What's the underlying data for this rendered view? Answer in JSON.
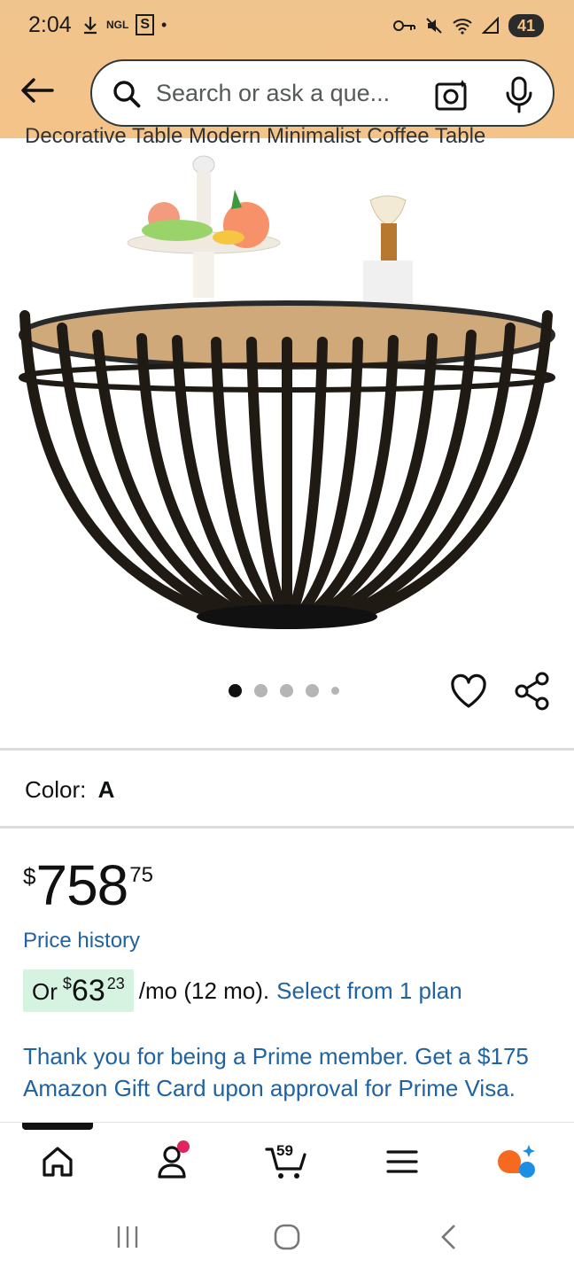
{
  "status_bar": {
    "time": "2:04",
    "left_icons": [
      "download-icon",
      "NGL",
      "S",
      "•"
    ],
    "right_icons": [
      "key-icon",
      "mute-icon",
      "wifi-icon",
      "signal-icon"
    ],
    "battery": "41"
  },
  "search": {
    "placeholder": "Search or ask a que..."
  },
  "product": {
    "title_partial": "Decorative Table Modern Minimalist Coffee Table",
    "image_count": 5,
    "active_image_index": 0
  },
  "color": {
    "label": "Color:",
    "value": "A"
  },
  "price": {
    "symbol": "$",
    "whole": "758",
    "fraction": "75"
  },
  "price_history_link": "Price history",
  "monthly": {
    "prefix": "Or",
    "symbol": "$",
    "whole": "63",
    "fraction": "23",
    "suffix": "/mo (12 mo).",
    "plan_link": "Select from 1 plan"
  },
  "prime_message": "Thank you for being a Prime member. Get a $175 Amazon Gift Card upon approval for Prime Visa.",
  "bottom_nav": {
    "cart_count": "59",
    "items": [
      "home-icon",
      "account-icon",
      "cart-icon",
      "menu-icon",
      "rufus-icon"
    ]
  },
  "colors": {
    "header_bg": "#f4c38a",
    "link": "#2162a1",
    "badge_bg": "#d6f3e1",
    "notif": "#e0245e"
  }
}
